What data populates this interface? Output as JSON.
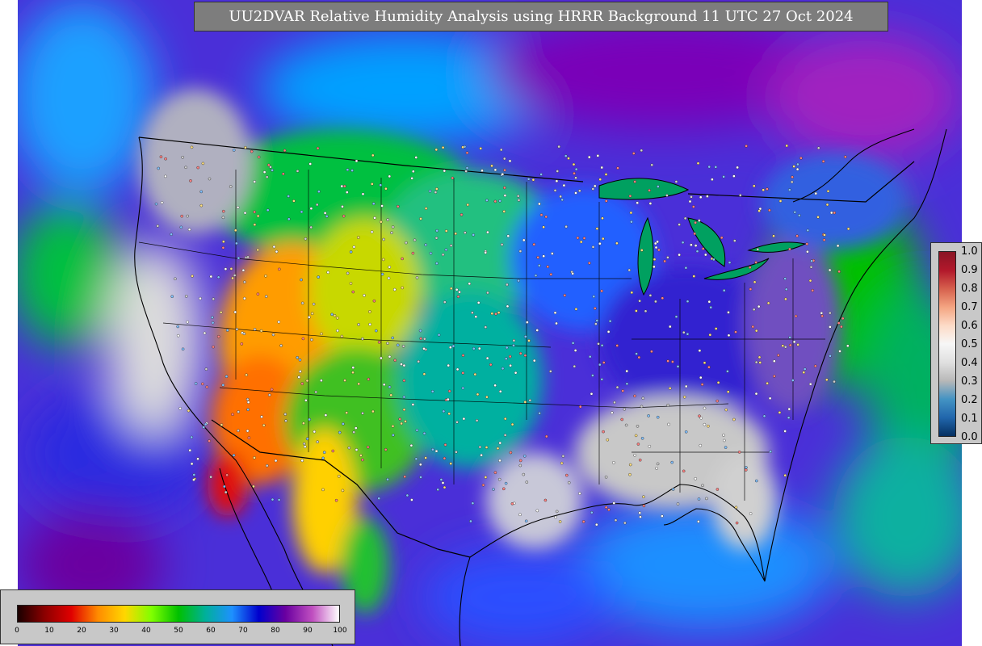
{
  "title": "UU2DVAR Relative Humidity Analysis using HRRR Background 11 UTC 27 Oct 2024",
  "map": {
    "field": "relative humidity",
    "region": "CONUS",
    "basemap_features": [
      "coastlines",
      "country-borders",
      "state-borders",
      "great-lakes"
    ],
    "observation_stations": "plotted-as-small-dots"
  },
  "legend_innovation": {
    "ticks": [
      "1.0",
      "0.9",
      "0.8",
      "0.7",
      "0.6",
      "0.5",
      "0.4",
      "0.3",
      "0.2",
      "0.1",
      "0.0"
    ],
    "colors_top_to_bottom": [
      "#8a1525",
      "#b2182b",
      "#d6604d",
      "#f4a582",
      "#fddbc7",
      "#f7f7f7",
      "#e0e0e0",
      "#b8b8b8",
      "#4393c3",
      "#2166ac",
      "#053061"
    ]
  },
  "legend_rh": {
    "ticks": [
      "0",
      "10",
      "20",
      "30",
      "40",
      "50",
      "60",
      "70",
      "80",
      "90",
      "100"
    ],
    "colors": [
      "#1a0000",
      "#8b0000",
      "#e00000",
      "#ff8c00",
      "#ffd700",
      "#7fff00",
      "#00c000",
      "#00b09a",
      "#1e90ff",
      "#0000cd",
      "#6a00a0",
      "#c04fc0",
      "#ffffff"
    ]
  }
}
